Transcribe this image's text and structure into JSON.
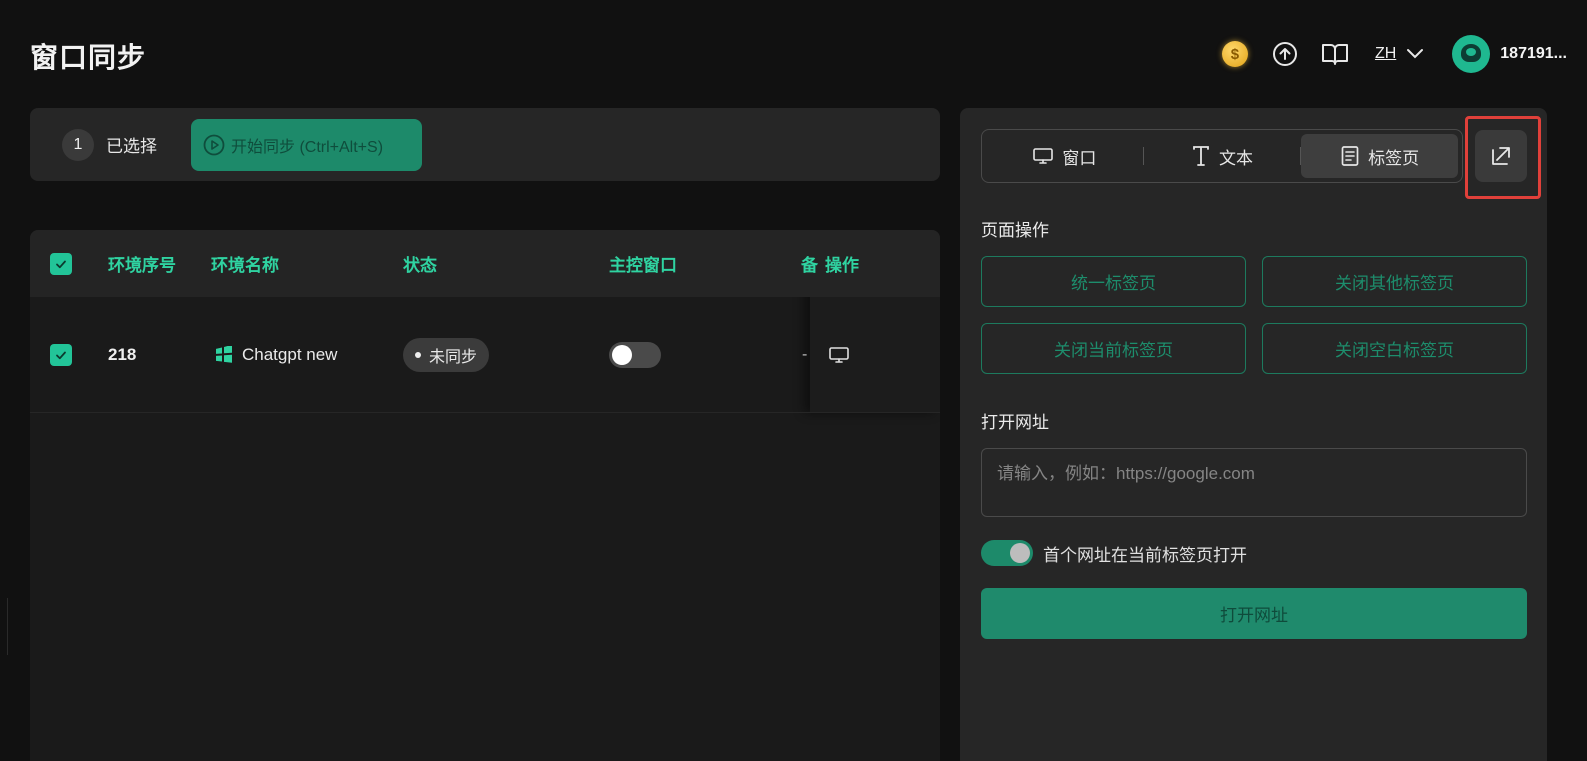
{
  "page": {
    "title": "窗口同步"
  },
  "topbar": {
    "coin_symbol": "$",
    "language": "ZH",
    "username": "187191..."
  },
  "actionbar": {
    "selected_count": "1",
    "selected_label": "已选择",
    "sync_button": "开始同步 (Ctrl+Alt+S)"
  },
  "table": {
    "headers": {
      "index": "环境序号",
      "name": "环境名称",
      "status": "状态",
      "master": "主控窗口",
      "group_partial": "备",
      "actions": "操作"
    },
    "rows": [
      {
        "index": "218",
        "name": "Chatgpt new",
        "status": "未同步",
        "master": false,
        "group_partial": "-"
      }
    ]
  },
  "panel": {
    "tabs": [
      {
        "label": "窗口",
        "icon": "monitor-icon",
        "active": false
      },
      {
        "label": "文本",
        "icon": "text-icon",
        "active": false
      },
      {
        "label": "标签页",
        "icon": "document-icon",
        "active": true
      }
    ],
    "page_ops_title": "页面操作",
    "page_ops": [
      "统一标签页",
      "关闭其他标签页",
      "关闭当前标签页",
      "关闭空白标签页"
    ],
    "open_url_title": "打开网址",
    "url_placeholder": "请输入，例如：https://google.com",
    "first_url_toggle_label": "首个网址在当前标签页打开",
    "first_url_toggle_on": true,
    "open_url_button": "打开网址"
  },
  "colors": {
    "accent": "#22c498",
    "accent_dark": "#1d8a6a",
    "highlight_box": "#e0403a",
    "background": "#111111",
    "panel": "#262626"
  }
}
